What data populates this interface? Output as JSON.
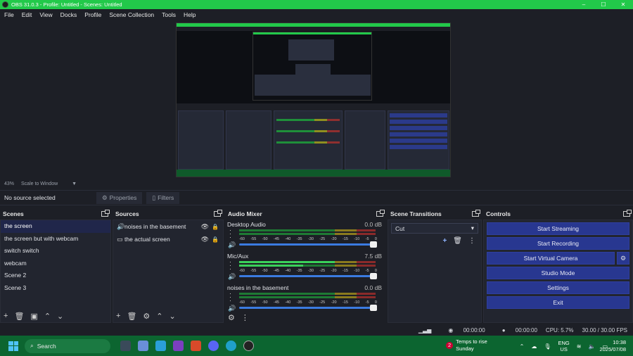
{
  "window": {
    "title": "OBS 31.0.3 - Profile: Untitled - Scenes: Untitled",
    "controls": [
      "–",
      "☐",
      "✕"
    ]
  },
  "menu": [
    "File",
    "Edit",
    "View",
    "Docks",
    "Profile",
    "Scene Collection",
    "Tools",
    "Help"
  ],
  "preview": {
    "zoom": "43%",
    "scale_mode": "Scale to Window"
  },
  "source_bar": {
    "no_source": "No source selected",
    "properties": "Properties",
    "filters": "Filters"
  },
  "scenes": {
    "title": "Scenes",
    "items": [
      "the screen",
      "the screen but with webcam",
      "switch switch",
      "webcam",
      "Scene 2",
      "Scene 3"
    ],
    "selected": "the screen"
  },
  "sources": {
    "title": "Sources",
    "items": [
      {
        "name": "noises in the basement",
        "icon": "speaker-icon"
      },
      {
        "name": "the actual screen",
        "icon": "monitor-icon"
      }
    ]
  },
  "audio_mixer": {
    "title": "Audio Mixer",
    "scale": [
      "-60",
      "-55",
      "-50",
      "-45",
      "-40",
      "-35",
      "-30",
      "-25",
      "-20",
      "-15",
      "-10",
      "-5",
      "0"
    ],
    "channels": [
      {
        "name": "Desktop Audio",
        "db": "0.0 dB",
        "level": 0.0,
        "volume": 1.0
      },
      {
        "name": "Mic/Aux",
        "db": "7.5 dB",
        "level": 0.7,
        "volume": 1.0
      },
      {
        "name": "noises in the basement",
        "db": "0.0 dB",
        "level": 0.0,
        "volume": 1.0
      }
    ]
  },
  "transitions": {
    "title": "Scene Transitions",
    "selected": "Cut"
  },
  "controls": {
    "title": "Controls",
    "start_streaming": "Start Streaming",
    "start_recording": "Start Recording",
    "start_virtual_camera": "Start Virtual Camera",
    "studio_mode": "Studio Mode",
    "settings": "Settings",
    "exit": "Exit"
  },
  "status": {
    "stream_time": "00:00:00",
    "rec_time": "00:00:00",
    "cpu": "CPU: 5.7%",
    "fps": "30.00 / 30.00 FPS"
  },
  "taskbar": {
    "search": "Search",
    "weather_title": "Temps to rise",
    "weather_sub": "Sunday",
    "weather_badge": "2",
    "lang_top": "ENG",
    "lang_bottom": "US",
    "time": "10:38",
    "date": "2025/07/08"
  },
  "colors": {
    "titlebar": "#22c94a",
    "taskbar": "#0c6530",
    "control_button": "#283790",
    "selection": "#20264a"
  }
}
